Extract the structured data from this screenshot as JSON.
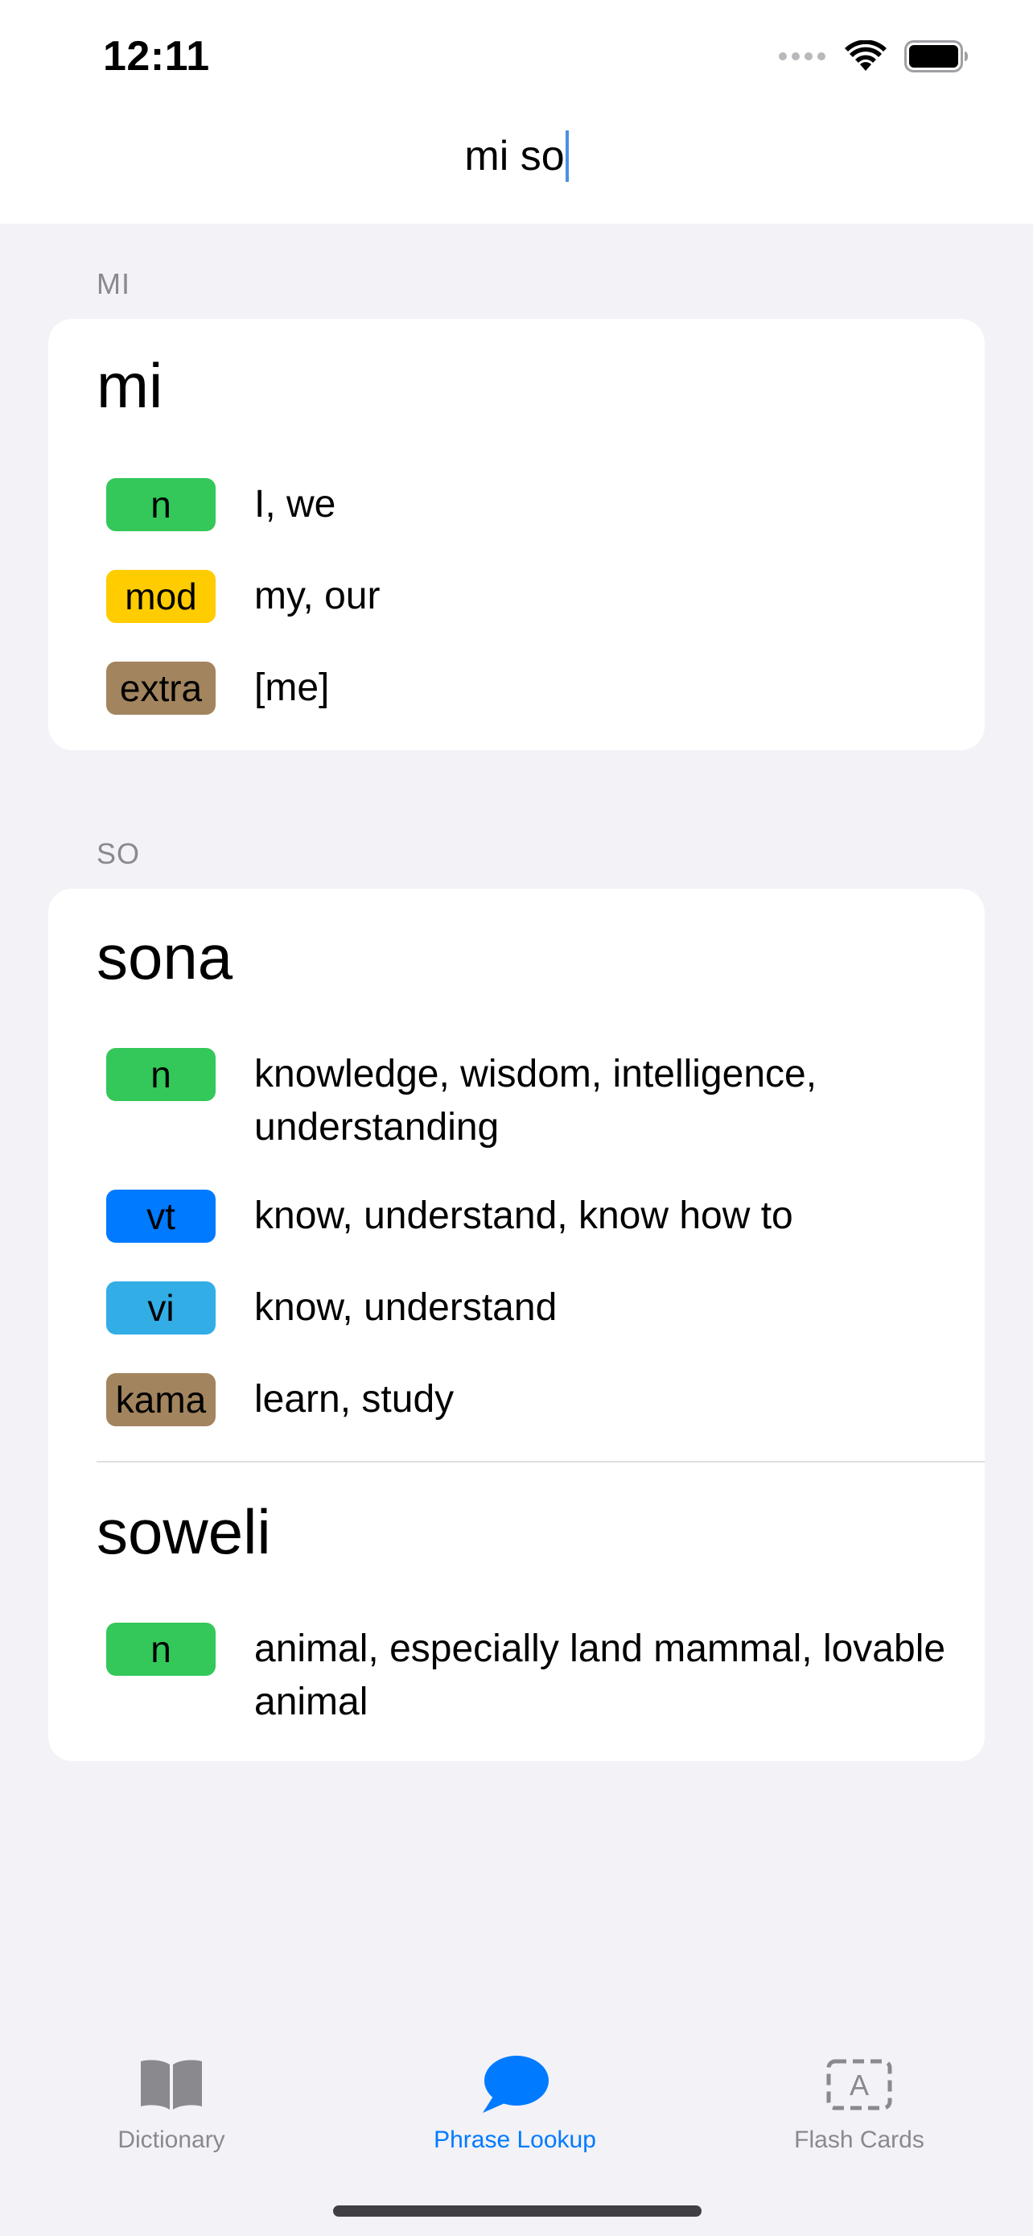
{
  "status_bar": {
    "time": "12:11"
  },
  "search": {
    "value": "mi so"
  },
  "sections": [
    {
      "header": "MI",
      "entries": [
        {
          "word": "mi",
          "definitions": [
            {
              "pos": "n",
              "text": "I, we",
              "color": "#34c759"
            },
            {
              "pos": "mod",
              "text": "my, our",
              "color": "#ffcc00"
            },
            {
              "pos": "extra",
              "text": "[me]",
              "color": "#a2845e"
            }
          ]
        }
      ]
    },
    {
      "header": "SO",
      "entries": [
        {
          "word": "sona",
          "definitions": [
            {
              "pos": "n",
              "text": "knowledge, wisdom, intelligence, understanding",
              "color": "#34c759"
            },
            {
              "pos": "vt",
              "text": "know, understand, know how to",
              "color": "#007aff"
            },
            {
              "pos": "vi",
              "text": "know, understand",
              "color": "#32ade6"
            },
            {
              "pos": "kama",
              "text": "learn, study",
              "color": "#a2845e"
            }
          ]
        },
        {
          "word": "soweli",
          "definitions": [
            {
              "pos": "n",
              "text": "animal, especially land mammal, lovable animal",
              "color": "#34c759"
            }
          ]
        }
      ]
    }
  ],
  "tabbar": {
    "active_color": "#007aff",
    "inactive_color": "#8a8a8e",
    "tabs": [
      {
        "label": "Dictionary",
        "icon": "book-icon",
        "active": false
      },
      {
        "label": "Phrase Lookup",
        "icon": "speech-bubble-icon",
        "active": true
      },
      {
        "label": "Flash Cards",
        "icon": "flash-card-icon",
        "active": false
      }
    ]
  }
}
